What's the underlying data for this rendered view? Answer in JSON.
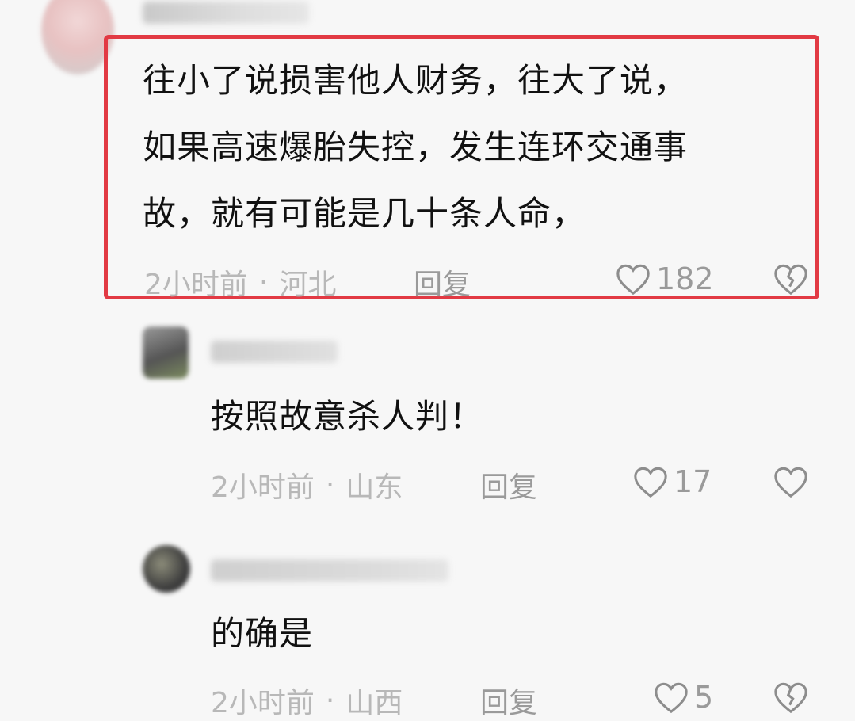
{
  "comments": [
    {
      "text": "往小了说损害他人财务，往大了说，\n如果高速爆胎失控，发生连环交通事\n故，就有可能是几十条人命，",
      "time": "2小时前",
      "location": "河北",
      "reply_label": "回复",
      "likes": "182"
    },
    {
      "text": "按照故意杀人判！",
      "time": "2小时前",
      "location": "山东",
      "reply_label": "回复",
      "likes": "17"
    },
    {
      "text": "的确是",
      "time": "2小时前",
      "location": "山西",
      "reply_label": "回复",
      "likes": "5"
    }
  ],
  "colors": {
    "highlight": "#e23a44",
    "meta": "#b8b8b8"
  },
  "icons": {
    "like": "heart-outline-icon",
    "dislike": "broken-heart-icon"
  }
}
